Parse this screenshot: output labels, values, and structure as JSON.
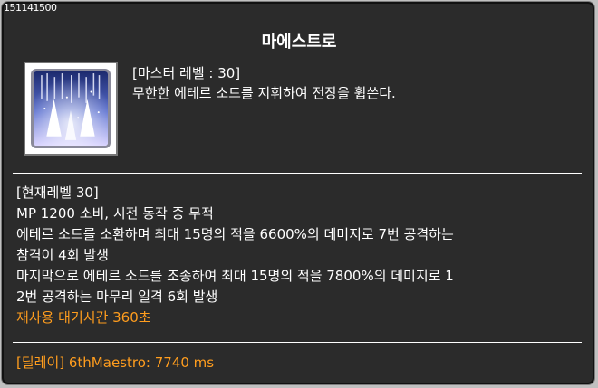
{
  "skill": {
    "id": "151141500",
    "name": "마에스트로",
    "master_level": "[마스터 레벨 : 30]",
    "description": "무한한 에테르 소드를 지휘하여 전장을 휩쓴다."
  },
  "details": {
    "current_level": "[현재레벨 30]",
    "line1": "MP 1200 소비, 시전 동작 중 무적",
    "line2": "에테르 소드를 소환하며 최대 15명의 적을 6600%의 데미지로 7번 공격하는",
    "line3": "참격이 4회 발생",
    "line4": "마지막으로 에테르 소드를 조종하여 최대 15명의 적을 7800%의 데미지로 1",
    "line5": "2번 공격하는 마무리 일격 6회 발생",
    "cooldown": "재사용 대기시간 360초"
  },
  "delay": "[딜레이] 6thMaestro: 7740 ms",
  "colors": {
    "background": "#2b2b2b",
    "text": "#ffffff",
    "highlight": "#ff9d1e"
  },
  "icon": "maestro-skill-icon"
}
